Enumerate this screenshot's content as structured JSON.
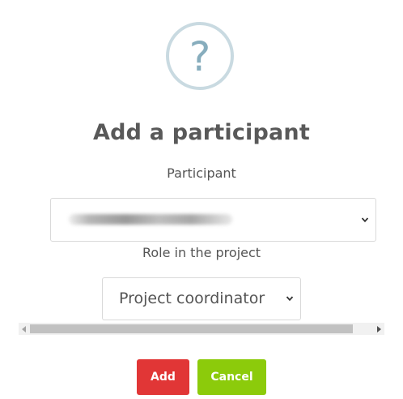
{
  "dialog": {
    "icon": "question-mark-icon",
    "icon_glyph": "?",
    "title": "Add a participant",
    "participant_label": "Participant",
    "participant_value": "",
    "role_label": "Role in the project",
    "role_value": "Project coordinator",
    "add_label": "Add",
    "cancel_label": "Cancel"
  },
  "colors": {
    "add_button": "#e13636",
    "cancel_button": "#8ccb0b",
    "icon_ring": "#c9dae1",
    "icon_glyph": "#87adbd"
  }
}
